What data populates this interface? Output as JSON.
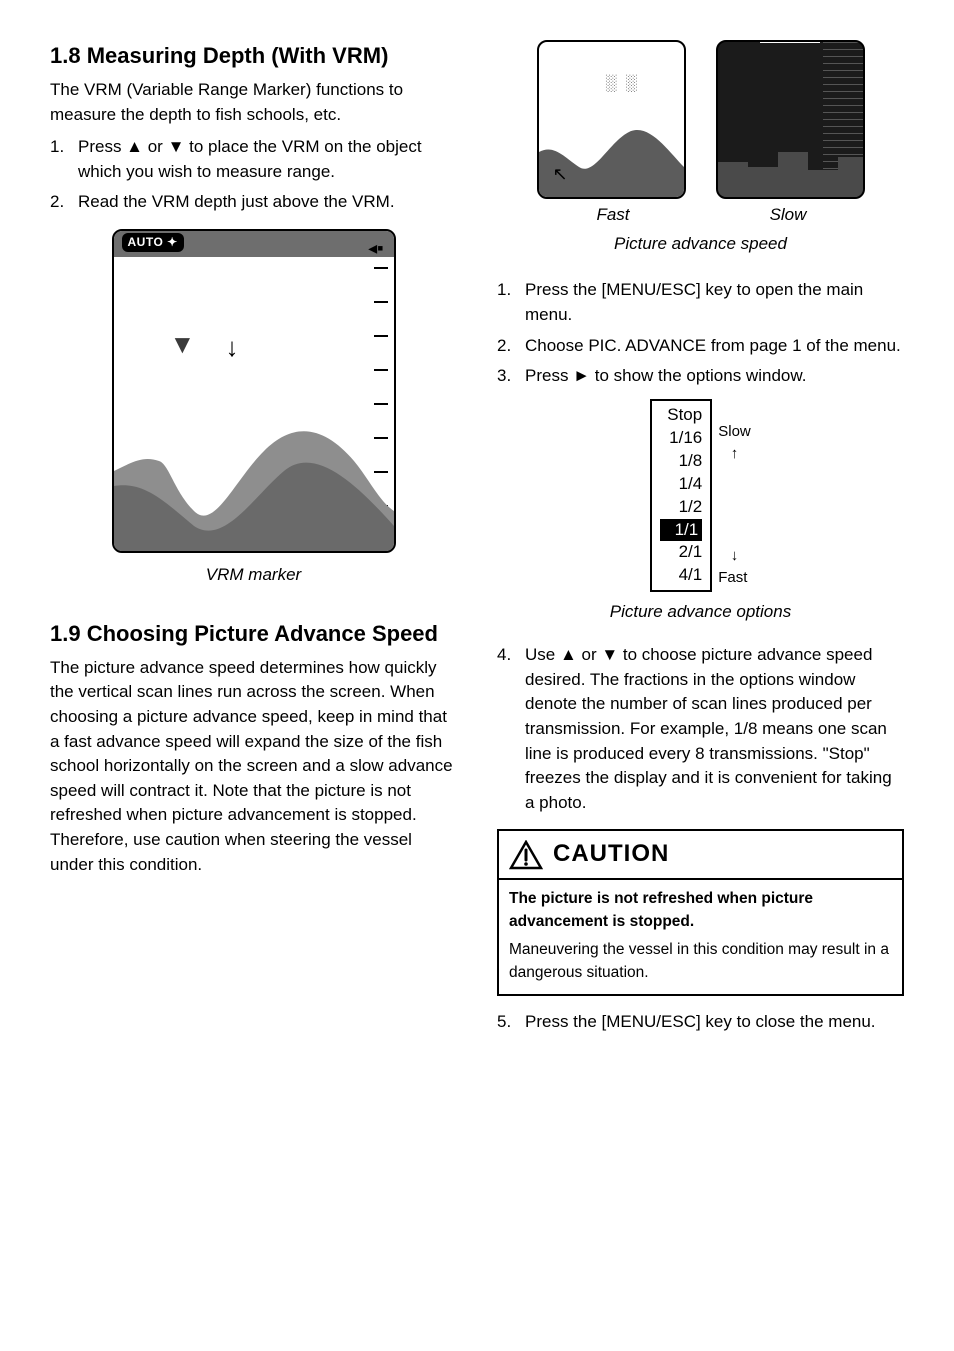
{
  "left": {
    "heading_num": "1.8",
    "heading_text": "Measuring Depth (With VRM)",
    "intro": "The VRM (Variable Range Marker) functions to measure the depth to fish schools, etc.",
    "steps": [
      "Press  ▲ or ▼ to place the VRM on the object which you wish to measure range.",
      "Read the VRM depth just above the VRM."
    ],
    "sonar_badge": "AUTO",
    "sonar_caption": "VRM marker",
    "sec2_num": "1.9",
    "sec2_text": "Choosing Picture Advance Speed",
    "sec2_para": "The picture advance speed determines how quickly the vertical scan lines run across the screen. When choosing a picture advance speed, keep in mind that a fast advance speed will expand the size of the fish school horizontally on the screen and a slow advance speed will contract it. Note that the picture is not refreshed when picture advancement is stopped. Therefore, use caution when steering the vessel under this condition."
  },
  "right": {
    "dual_label_left": "Fast",
    "dual_label_right": "Slow",
    "dual_caption": "Picture advance speed",
    "steps_a": [
      "Press the [MENU/ESC] key to open the main menu.",
      "Choose PIC. ADVANCE from page 1 of the menu.",
      "Press ► to show the options window."
    ],
    "options": {
      "items": [
        "Stop",
        "1/16",
        "1/8",
        "1/4",
        "1/2",
        "1/1",
        "2/1",
        "4/1"
      ],
      "selected_index": 5,
      "slow_label": "Slow",
      "fast_label": "Fast"
    },
    "options_caption": "Picture advance options",
    "step4": "Use ▲ or ▼ to choose picture advance speed desired. The fractions in the options window denote the number of scan lines produced per transmission. For example, 1/8 means one scan line is produced every 8 transmissions. \"Stop\" freezes the display and it is convenient for taking a photo.",
    "caution": {
      "label": "CAUTION",
      "lead": "The picture is not refreshed when picture advancement is stopped.",
      "body": "Maneuvering the vessel in this condition may result in a dangerous situation."
    },
    "step5": "Press the [MENU/ESC] key to close the menu."
  }
}
